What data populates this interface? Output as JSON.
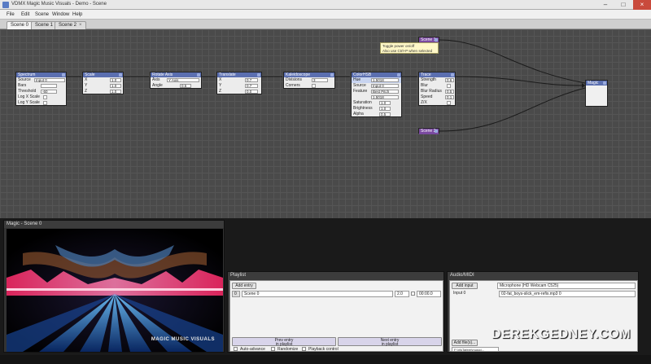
{
  "window": {
    "title": "VDMX Magic Music Visuals - Demo - Scene",
    "minimize": "–",
    "maximize": "□",
    "close": "×"
  },
  "menu": [
    "File",
    "Edit",
    "Scene",
    "Window",
    "Help"
  ],
  "tabs": [
    {
      "label": "Scene 0",
      "close": "×"
    },
    {
      "label": "Scene 1",
      "close": "×"
    },
    {
      "label": "Scene 2",
      "close": "×"
    }
  ],
  "nodes": {
    "spectrum": {
      "title": "Spectrum",
      "rows": [
        {
          "label": "Source",
          "value": "Input 0"
        },
        {
          "label": "Bars",
          "value": ""
        },
        {
          "label": "Threshold",
          "value": "-60"
        },
        {
          "label": "Log X Scale",
          "value": ""
        },
        {
          "label": "Log Y Scale",
          "value": ""
        }
      ]
    },
    "scale": {
      "title": "Scale",
      "rows": [
        {
          "label": "X",
          "value": "1.0"
        },
        {
          "label": "Y",
          "value": "1.0"
        },
        {
          "label": "Z",
          "value": "1.0"
        }
      ]
    },
    "rotate": {
      "title": "Rotate Axis",
      "rows": [
        {
          "label": "Axis",
          "value": "Y Axis"
        },
        {
          "label": "Angle",
          "value": "0.5"
        }
      ]
    },
    "translate": {
      "title": "Translate",
      "rows": [
        {
          "label": "X",
          "value": "0.7"
        },
        {
          "label": "Y",
          "value": "0.7"
        },
        {
          "label": "Z",
          "value": "0.0"
        }
      ]
    },
    "kaleido": {
      "title": "Kaleidoscope",
      "rows": [
        {
          "label": "Divisions",
          "value": "3"
        },
        {
          "label": "Corners",
          "value": ""
        }
      ]
    },
    "colorhsb": {
      "title": "ColorHSB",
      "rows": [
        {
          "label": "Hue",
          "value": "1.5018"
        },
        {
          "label": "Source",
          "value": "Input 0"
        },
        {
          "label": "Feature",
          "value": "Best Pitch"
        },
        {
          "label": "",
          "value": "1.5018"
        },
        {
          "label": "Saturation",
          "value": "1.0"
        },
        {
          "label": "Brightness",
          "value": "1.0"
        },
        {
          "label": "Alpha",
          "value": "0.5"
        }
      ]
    },
    "trace": {
      "title": "Trace",
      "rows": [
        {
          "label": "Strength",
          "value": "0.6"
        },
        {
          "label": "Blur",
          "value": ""
        },
        {
          "label": "Blur Radius",
          "value": "0.5"
        },
        {
          "label": "Speed",
          "value": "0.1"
        },
        {
          "label": "Z/X",
          "value": ""
        }
      ]
    },
    "scene1": {
      "title": "Scene 1"
    },
    "scene2": {
      "title": "Scene 2"
    },
    "magic": {
      "title": "Magic"
    }
  },
  "tooltip": {
    "line1": "Toggle power on/off",
    "line2": "Also use Ctrl+P when selected"
  },
  "preview": {
    "title": "Magic - Scene 0",
    "caption": "MAGIC MUSIC VISUALS"
  },
  "playlist": {
    "title": "Playlist",
    "add_entry": "Add entry",
    "entry_index": "0",
    "entry_scene": "Scene 0",
    "entry_beats": "2.0",
    "entry_time": "00:00.0",
    "prev_label": "Prev entry\nin playlist",
    "next_label": "Next entry\nin playlist",
    "auto_advance": "Auto-advance",
    "randomize": "Randomize",
    "playback_control": "Playback control"
  },
  "audio": {
    "title": "Audio/MIDI",
    "add_input": "Add input",
    "device": "Microphone (HD Webcam C525)",
    "input_label": "Input 0",
    "input_file": "02-fat_boys-slick_em-refix.mp3 0",
    "add_file": "Add file(s)...",
    "path": "F:\\VisTafeer\\music\\..."
  },
  "watermark": "DEREKGEDNEY.COM"
}
